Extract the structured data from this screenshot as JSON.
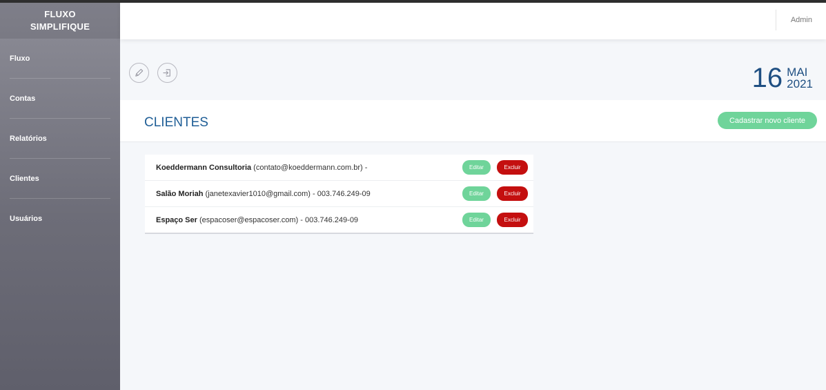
{
  "brand": {
    "line1": "FLUXO",
    "line2": "SIMPLIFIQUE"
  },
  "sidebar": {
    "items": [
      {
        "label": "Fluxo"
      },
      {
        "label": "Contas"
      },
      {
        "label": "Relatórios"
      },
      {
        "label": "Clientes"
      },
      {
        "label": "Usuários"
      }
    ]
  },
  "header": {
    "user": "Admin"
  },
  "toolbar": {
    "icons": [
      "pencil-icon",
      "sign-in-icon"
    ]
  },
  "date": {
    "day": "16",
    "month": "MAI",
    "year": "2021"
  },
  "main": {
    "title": "CLIENTES",
    "new_button_label": "Cadastrar novo cliente",
    "clients": [
      {
        "name": "Koeddermann Consultoria",
        "details": " (contato@koeddermann.com.br) -"
      },
      {
        "name": "Salão Moriah",
        "details": " (janetexavier1010@gmail.com) - 003.746.249-09"
      },
      {
        "name": "Espaço Ser",
        "details": " (espacoser@espacoser.com) - 003.746.249-09"
      }
    ],
    "edit_label": "Editar",
    "delete_label": "Excluir"
  },
  "colors": {
    "accent_green": "#6fd49a",
    "danger_red": "#c40f0f",
    "title_blue": "#1f5e96",
    "date_blue": "#1f4f82"
  }
}
